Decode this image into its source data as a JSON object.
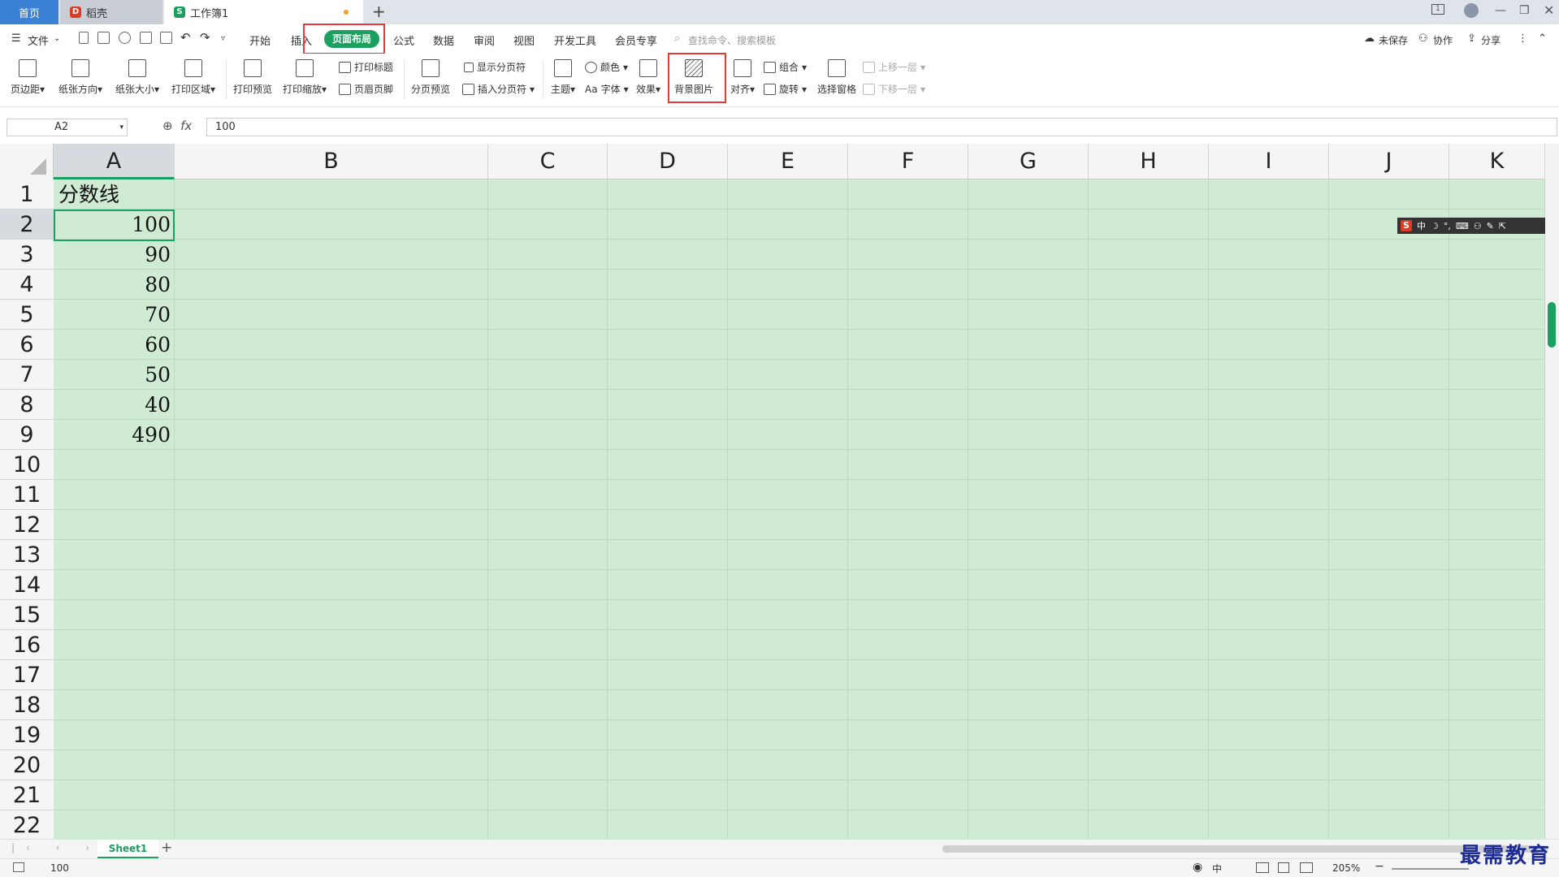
{
  "tabs": {
    "home": "首页",
    "daoke": "稻壳",
    "workbook": "工作簿1",
    "add": "+"
  },
  "menu": {
    "file": "文件",
    "start": "开始",
    "insert": "插入",
    "page_layout": "页面布局",
    "formula": "公式",
    "data": "数据",
    "review": "审阅",
    "view": "视图",
    "dev": "开发工具",
    "member": "会员专享",
    "search_placeholder": "查找命令、搜索模板",
    "unsaved": "未保存",
    "collab": "协作",
    "share": "分享"
  },
  "ribbon": {
    "margins": "页边距",
    "orientation": "纸张方向",
    "size": "纸张大小",
    "print_area": "打印区域",
    "print_preview": "打印预览",
    "print_scale": "打印缩放",
    "print_titles": "打印标题",
    "header_footer": "页眉页脚",
    "page_break_preview": "分页预览",
    "show_breaks": "显示分页符",
    "insert_break": "插入分页符",
    "theme": "主题",
    "color": "颜色",
    "font": "字体",
    "effect": "效果",
    "bg_image": "背景图片",
    "align": "对齐",
    "group": "组合",
    "rotate": "旋转",
    "selection_pane": "选择窗格",
    "bring_forward": "上移一层",
    "send_backward": "下移一层"
  },
  "formula_bar": {
    "cell_ref": "A2",
    "fx": "fx",
    "value": "100"
  },
  "columns": [
    "A",
    "B",
    "C",
    "D",
    "E",
    "F",
    "G",
    "H",
    "I",
    "J",
    "K"
  ],
  "rows": [
    "1",
    "2",
    "3",
    "4",
    "5",
    "6",
    "7",
    "8",
    "9",
    "10",
    "11",
    "12",
    "13",
    "14",
    "15",
    "16",
    "17",
    "18",
    "19",
    "20",
    "21",
    "22"
  ],
  "cells": {
    "A1": "分数线",
    "A2": "100",
    "A3": "90",
    "A4": "80",
    "A5": "70",
    "A6": "60",
    "A7": "50",
    "A8": "40",
    "A9": "490"
  },
  "ime": {
    "lang": "中"
  },
  "sheets": [
    "Sheet1"
  ],
  "status": {
    "value": "100",
    "zoom": "205%"
  },
  "watermark": "最需教育",
  "colors": {
    "accent": "#1ba05f",
    "highlight": "#e43a3a",
    "grid_bg": "#d0ebd4",
    "tab_blue": "#3b82d6"
  }
}
